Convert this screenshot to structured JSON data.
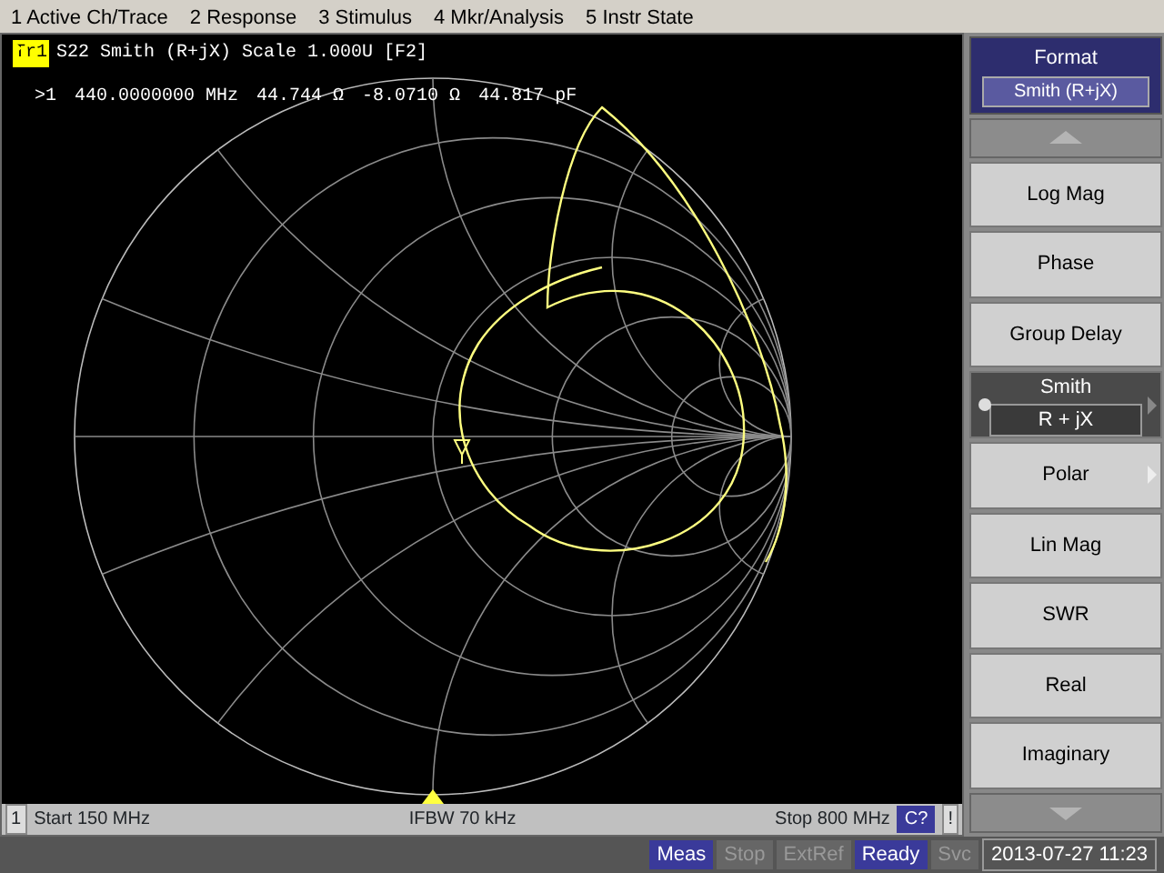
{
  "menu_bar": [
    "1 Active Ch/Trace",
    "2 Response",
    "3 Stimulus",
    "4 Mkr/Analysis",
    "5 Instr State"
  ],
  "trace_header": {
    "trace": "Tr1",
    "label": "S22 Smith (R+jX) Scale 1.000U [F2]"
  },
  "marker_readout": {
    "marker": ">1",
    "frequency": "440.0000000 MHz",
    "resistance": "44.744 Ω",
    "reactance": "-8.0710 Ω",
    "capacitance": "44.817 pF"
  },
  "channel_bar": {
    "channel": "1",
    "start": "Start 150 MHz",
    "ifbw": "IFBW 70 kHz",
    "stop": "Stop 800 MHz",
    "cal": "C?",
    "flag": "!"
  },
  "softkey_panel": {
    "title": "Format",
    "value": "Smith (R+jX)",
    "keys": [
      {
        "label": "Log Mag",
        "kind": "plain",
        "selected": false
      },
      {
        "label": "Phase",
        "kind": "plain",
        "selected": false
      },
      {
        "label": "Group Delay",
        "kind": "plain",
        "selected": false
      },
      {
        "label": "Smith",
        "value": "R + jX",
        "kind": "submenu",
        "selected": true
      },
      {
        "label": "Polar",
        "kind": "submenu",
        "selected": false
      },
      {
        "label": "Lin Mag",
        "kind": "plain",
        "selected": false
      },
      {
        "label": "SWR",
        "kind": "plain",
        "selected": false
      },
      {
        "label": "Real",
        "kind": "plain",
        "selected": false
      },
      {
        "label": "Imaginary",
        "kind": "plain",
        "selected": false
      }
    ]
  },
  "status_bar": {
    "indicators": [
      {
        "label": "Meas",
        "active": true
      },
      {
        "label": "Stop",
        "active": false
      },
      {
        "label": "ExtRef",
        "active": false
      },
      {
        "label": "Ready",
        "active": true
      },
      {
        "label": "Svc",
        "active": false
      }
    ],
    "datetime": "2013-07-27 11:23"
  }
}
